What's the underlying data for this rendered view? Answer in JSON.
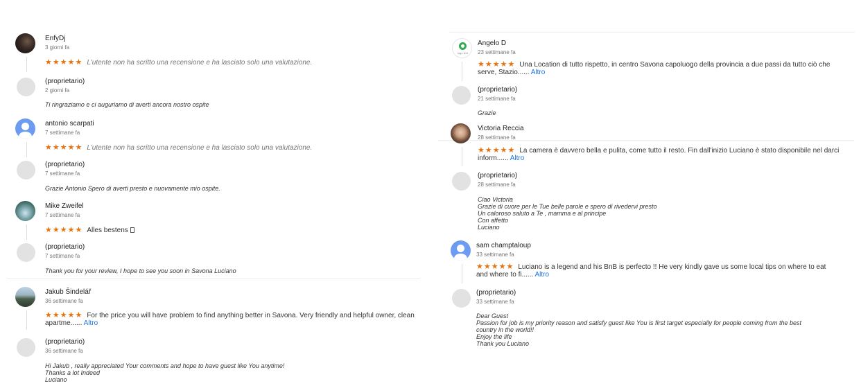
{
  "left": {
    "entries": [
      {
        "name": "EnfyDj",
        "time": "3 giorni fa",
        "stars": "★★★★★",
        "text": "L'utente non ha scritto una recensione e ha lasciato solo una valutazione.",
        "more": ""
      },
      {
        "name": "(proprietario)",
        "time": "2 giorni fa",
        "reply": [
          "Ti ringraziamo e ci auguriamo di averti ancora nostro ospite"
        ]
      },
      {
        "name": "antonio scarpati",
        "time": "7 settimane fa",
        "stars": "★★★★★",
        "text": "L'utente non ha scritto una recensione e ha lasciato solo una valutazione.",
        "more": ""
      },
      {
        "name": "(proprietario)",
        "time": "7 settimane fa",
        "reply": [
          "Grazie Antonio Spero di averti presto e nuovamente mio ospite."
        ]
      },
      {
        "name": "Mike Zweifel",
        "time": "7 settimane fa",
        "stars": "★★★★★",
        "text": "Alles bestens ",
        "more": ""
      },
      {
        "name": "(proprietario)",
        "time": "7 settimane fa",
        "reply": [
          "Thank you for your review, I hope to see you soon in Savona Luciano"
        ]
      },
      {
        "name": "Jakub Šindelář",
        "time": "36 settimane fa",
        "stars": "★★★★★",
        "text": "For the price you will have problem to find anything better in Savona. Very friendly and helpful owner, clean apartme......",
        "more": "Altro"
      },
      {
        "name": "(proprietario)",
        "time": "36 settimane fa",
        "reply": [
          "Hi Jakub , really appreciated Your comments and hope to have guest like You anytime!",
          "Thanks a lot Indeed",
          "Luciano"
        ]
      }
    ]
  },
  "right": {
    "entries": [
      {
        "name": "Angelo D",
        "time": "23 settimane fa",
        "stars": "★★★★★",
        "text": "Una Location di tutto rispetto, in centro Savona capoluogo della provincia a due passi da tutto ciò che serve, Stazio......",
        "more": "Altro",
        "logo_text": "logo text"
      },
      {
        "name": "(proprietario)",
        "time": "21 settimane fa",
        "reply": [
          "Grazie"
        ]
      },
      {
        "name": "Victoria Reccia",
        "time": "28 settimane fa",
        "stars": "★★★★★",
        "text": "La camera è davvero bella e pulita, come tutto il resto. Fin dall'inizio Luciano è stato disponibile nel darci inform......",
        "more": "Altro"
      },
      {
        "name": "(proprietario)",
        "time": "28 settimane fa",
        "reply": [
          "Ciao Victoria",
          "Grazie di cuore per le Tue belle parole e spero di rivedervi presto",
          "Un caloroso saluto a Te , mamma e al principe",
          "Con affetto",
          "Luciano"
        ]
      },
      {
        "name": "sam champtaloup",
        "time": "33 settimane fa",
        "stars": "★★★★★",
        "text": "Luciano is a legend and his BnB is perfecto !! He very kindly gave us some local tips on where to eat and where to fi......",
        "more": "Altro"
      },
      {
        "name": "(proprietario)",
        "time": "33 settimane fa",
        "reply": [
          "Dear Guest",
          "Passion for job is my priority reason and satisfy guest like You is first target especially for people coming from the best",
          "country in the world!!",
          "Enjoy the life",
          "Thank you Luciano"
        ]
      }
    ]
  },
  "colors": {
    "star": "#e8710a",
    "link": "#1a73e8",
    "muted": "#757575",
    "divider": "#ececec"
  }
}
